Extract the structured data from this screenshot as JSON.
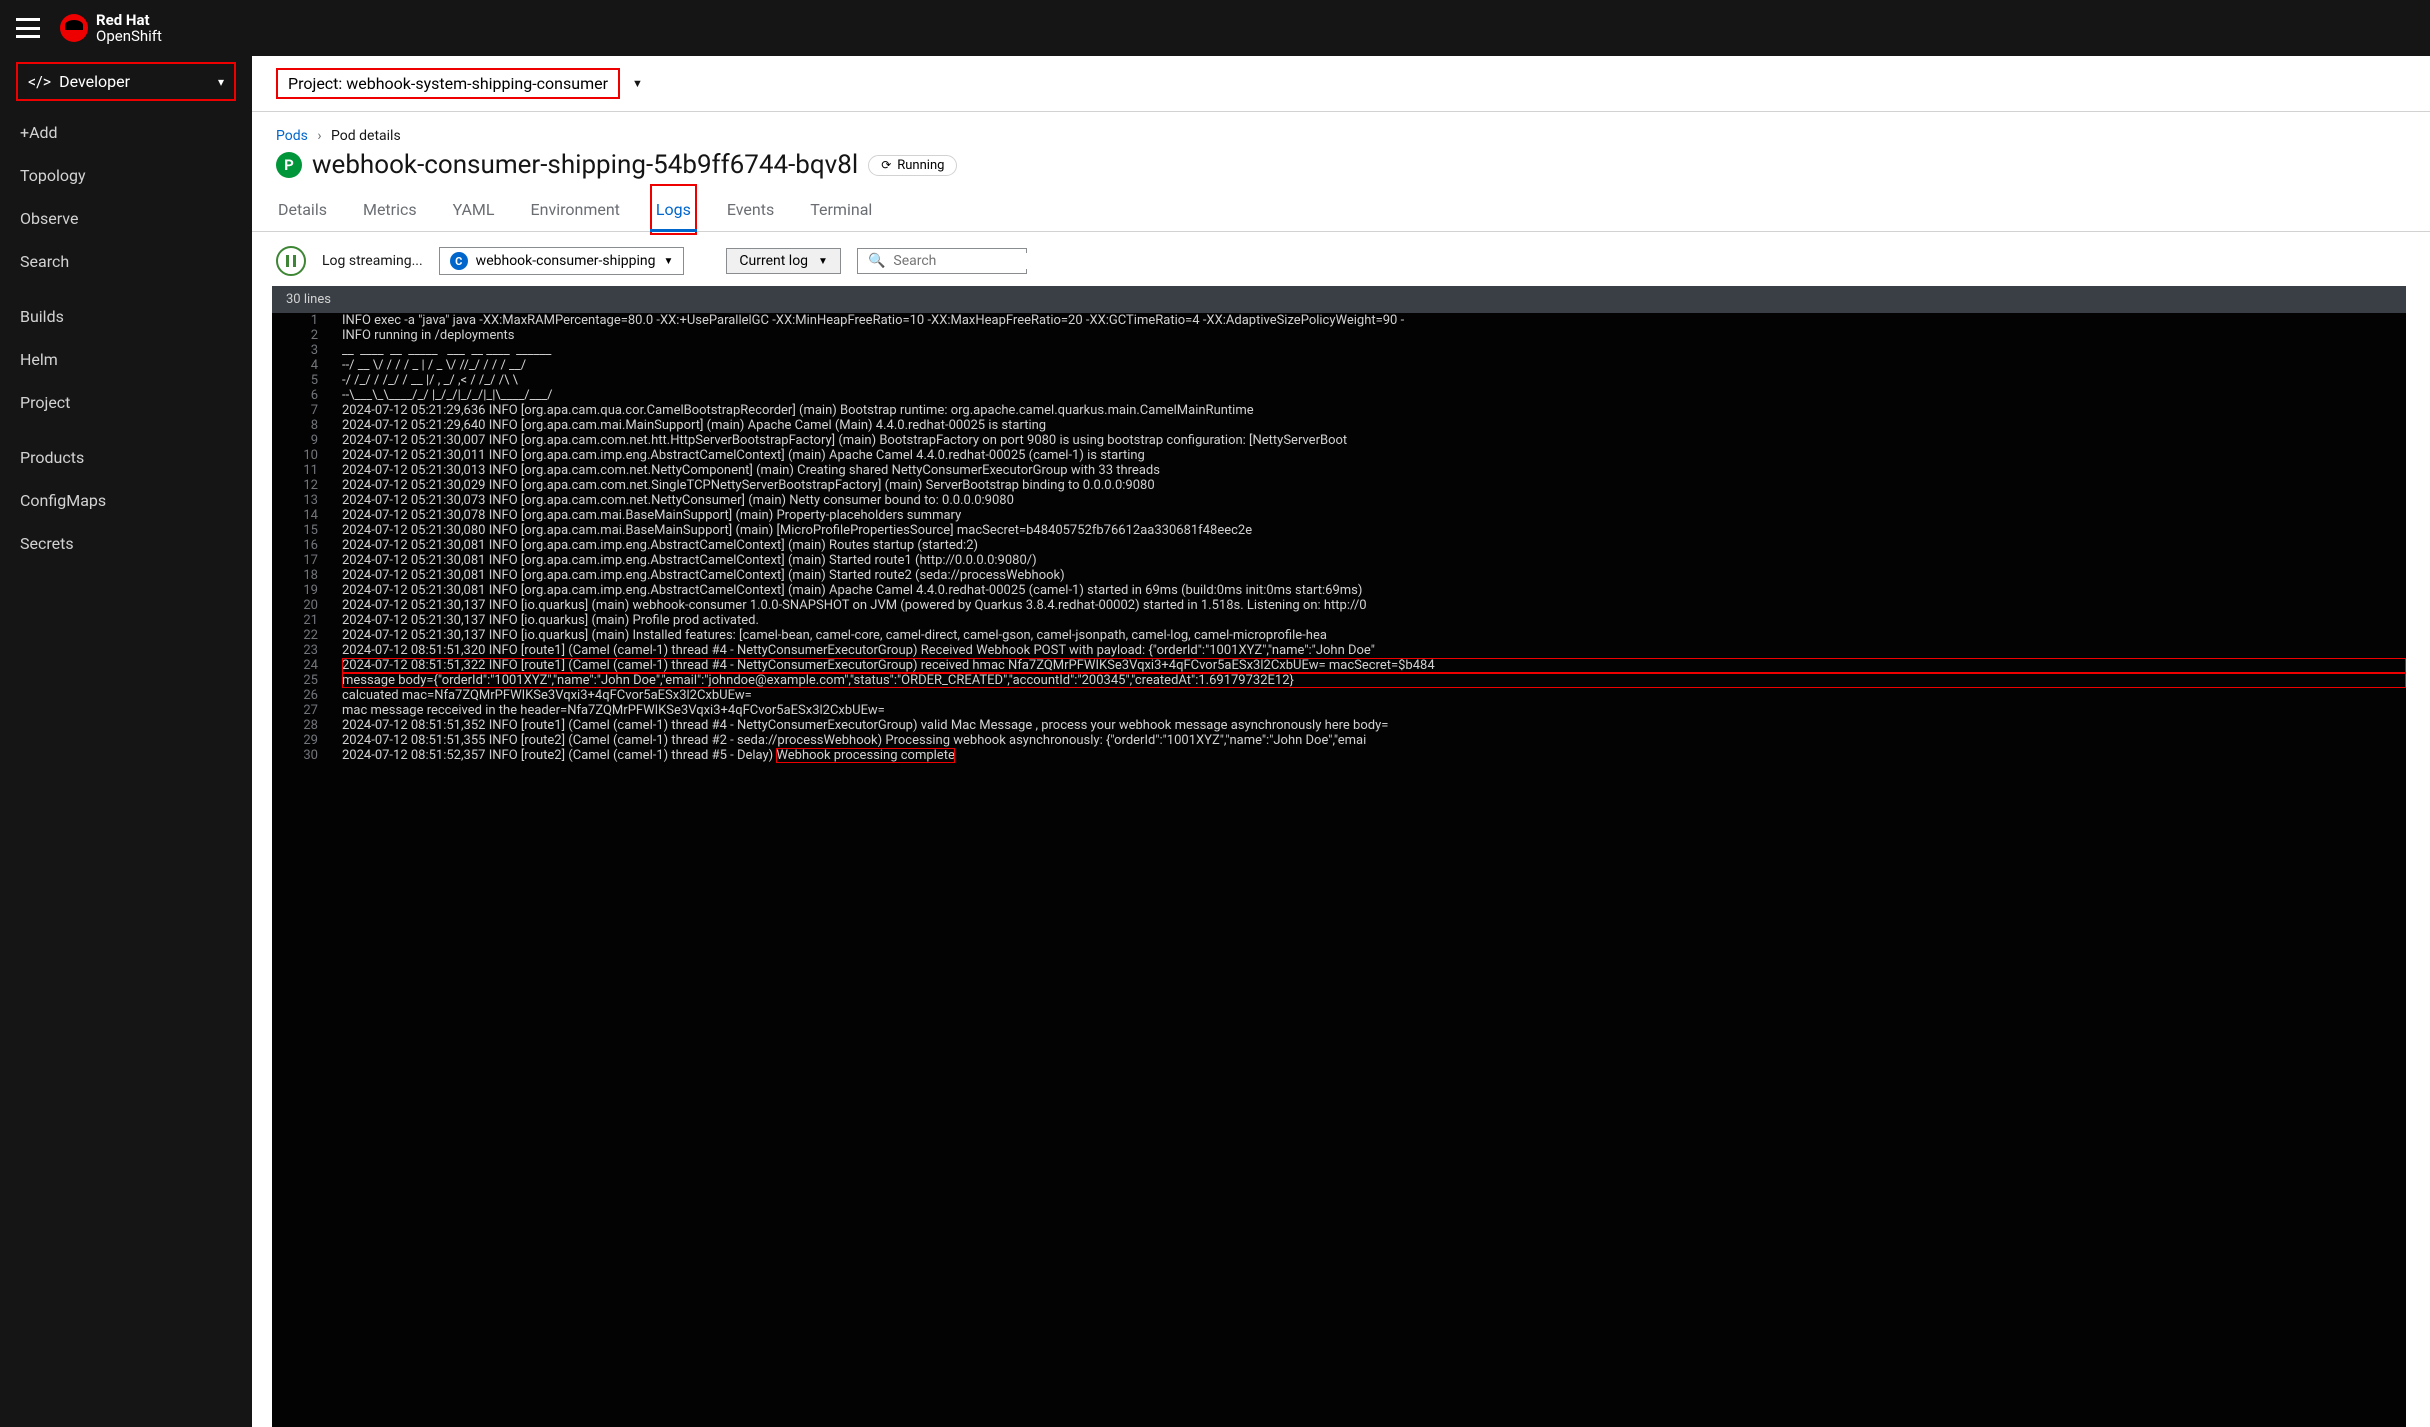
{
  "brand": {
    "line1": "Red Hat",
    "line2": "OpenShift"
  },
  "perspective": {
    "label": "Developer"
  },
  "sidebar": {
    "items": [
      {
        "label": "+Add"
      },
      {
        "label": "Topology"
      },
      {
        "label": "Observe"
      },
      {
        "label": "Search"
      },
      {
        "label": "Builds"
      },
      {
        "label": "Helm"
      },
      {
        "label": "Project"
      },
      {
        "label": "Products"
      },
      {
        "label": "ConfigMaps"
      },
      {
        "label": "Secrets"
      }
    ]
  },
  "project": {
    "prefix": "Project: ",
    "name": "webhook-system-shipping-consumer"
  },
  "breadcrumb": {
    "root": "Pods",
    "current": "Pod details"
  },
  "pod": {
    "badge": "P",
    "name": "webhook-consumer-shipping-54b9ff6744-bqv8l",
    "status": "Running"
  },
  "tabs": [
    "Details",
    "Metrics",
    "YAML",
    "Environment",
    "Logs",
    "Events",
    "Terminal"
  ],
  "active_tab": 4,
  "toolbar": {
    "streaming": "Log streaming...",
    "container_badge": "C",
    "container": "webhook-consumer-shipping",
    "current_log": "Current log",
    "search_placeholder": "Search"
  },
  "log": {
    "count_label": "30 lines",
    "lines": [
      "INFO exec -a \"java\" java -XX:MaxRAMPercentage=80.0 -XX:+UseParallelGC -XX:MinHeapFreeRatio=10 -XX:MaxHeapFreeRatio=20 -XX:GCTimeRatio=4 -XX:AdaptiveSizePolicyWeight=90 -",
      "INFO running in /deployments",
      "__  ____  __  _____   ___  __ ____  ______",
      "--/ __ \\/ / / / _ | / _ \\/ //_/ / / / __/",
      "-/ /_/ / /_/ / __ |/ , _/ ,< / /_/ /\\ \\",
      "--\\___\\_\\____/_/ |_/_/|_/_/|_|\\____/___/",
      "2024-07-12 05:21:29,636 INFO [org.apa.cam.qua.cor.CamelBootstrapRecorder] (main) Bootstrap runtime: org.apache.camel.quarkus.main.CamelMainRuntime",
      "2024-07-12 05:21:29,640 INFO [org.apa.cam.mai.MainSupport] (main) Apache Camel (Main) 4.4.0.redhat-00025 is starting",
      "2024-07-12 05:21:30,007 INFO [org.apa.cam.com.net.htt.HttpServerBootstrapFactory] (main) BootstrapFactory on port 9080 is using bootstrap configuration: [NettyServerBoot",
      "2024-07-12 05:21:30,011 INFO [org.apa.cam.imp.eng.AbstractCamelContext] (main) Apache Camel 4.4.0.redhat-00025 (camel-1) is starting",
      "2024-07-12 05:21:30,013 INFO [org.apa.cam.com.net.NettyComponent] (main) Creating shared NettyConsumerExecutorGroup with 33 threads",
      "2024-07-12 05:21:30,029 INFO [org.apa.cam.com.net.SingleTCPNettyServerBootstrapFactory] (main) ServerBootstrap binding to 0.0.0.0:9080",
      "2024-07-12 05:21:30,073 INFO [org.apa.cam.com.net.NettyConsumer] (main) Netty consumer bound to: 0.0.0.0:9080",
      "2024-07-12 05:21:30,078 INFO [org.apa.cam.mai.BaseMainSupport] (main) Property-placeholders summary",
      "2024-07-12 05:21:30,080 INFO [org.apa.cam.mai.BaseMainSupport] (main) [MicroProfilePropertiesSource] macSecret=b48405752fb76612aa330681f48eec2e",
      "2024-07-12 05:21:30,081 INFO [org.apa.cam.imp.eng.AbstractCamelContext] (main) Routes startup (started:2)",
      "2024-07-12 05:21:30,081 INFO [org.apa.cam.imp.eng.AbstractCamelContext] (main) Started route1 (http://0.0.0.0:9080/)",
      "2024-07-12 05:21:30,081 INFO [org.apa.cam.imp.eng.AbstractCamelContext] (main) Started route2 (seda://processWebhook)",
      "2024-07-12 05:21:30,081 INFO [org.apa.cam.imp.eng.AbstractCamelContext] (main) Apache Camel 4.4.0.redhat-00025 (camel-1) started in 69ms (build:0ms init:0ms start:69ms)",
      "2024-07-12 05:21:30,137 INFO [io.quarkus] (main) webhook-consumer 1.0.0-SNAPSHOT on JVM (powered by Quarkus 3.8.4.redhat-00002) started in 1.518s. Listening on: http://0",
      "2024-07-12 05:21:30,137 INFO [io.quarkus] (main) Profile prod activated.",
      "2024-07-12 05:21:30,137 INFO [io.quarkus] (main) Installed features: [camel-bean, camel-core, camel-direct, camel-gson, camel-jsonpath, camel-log, camel-microprofile-hea",
      "2024-07-12 08:51:51,320 INFO [route1] (Camel (camel-1) thread #4 - NettyConsumerExecutorGroup) Received Webhook POST with payload: {\"orderId\":\"1001XYZ\",\"name\":\"John Doe\"",
      "2024-07-12 08:51:51,322 INFO [route1] (Camel (camel-1) thread #4 - NettyConsumerExecutorGroup) received hmac Nfa7ZQMrPFWIKSe3Vqxi3+4qFCvor5aESx3l2CxbUEw= macSecret=$b484",
      "message body={\"orderId\":\"1001XYZ\",\"name\":\"John Doe\",\"email\":\"johndoe@example.com\",\"status\":\"ORDER_CREATED\",\"accountId\":\"200345\",\"createdAt\":1.69179732E12}",
      "calcuated mac=Nfa7ZQMrPFWIKSe3Vqxi3+4qFCvor5aESx3l2CxbUEw=",
      "mac message recceived in the header=Nfa7ZQMrPFWIKSe3Vqxi3+4qFCvor5aESx3l2CxbUEw=",
      "2024-07-12 08:51:51,352 INFO [route1] (Camel (camel-1) thread #4 - NettyConsumerExecutorGroup) valid Mac Message , process your webhook message asynchronously here body=",
      "2024-07-12 08:51:51,355 INFO [route2] (Camel (camel-1) thread #2 - seda://processWebhook) Processing webhook asynchronously: {\"orderId\":\"1001XYZ\",\"name\":\"John Doe\",\"emai",
      "2024-07-12 08:51:52,357 INFO [route2] (Camel (camel-1) thread #5 - Delay) Webhook processing complete"
    ],
    "highlight_lines": [
      24,
      25
    ],
    "highlight_segment_line": 30,
    "highlight_segment_text": "Webhook processing complete"
  }
}
